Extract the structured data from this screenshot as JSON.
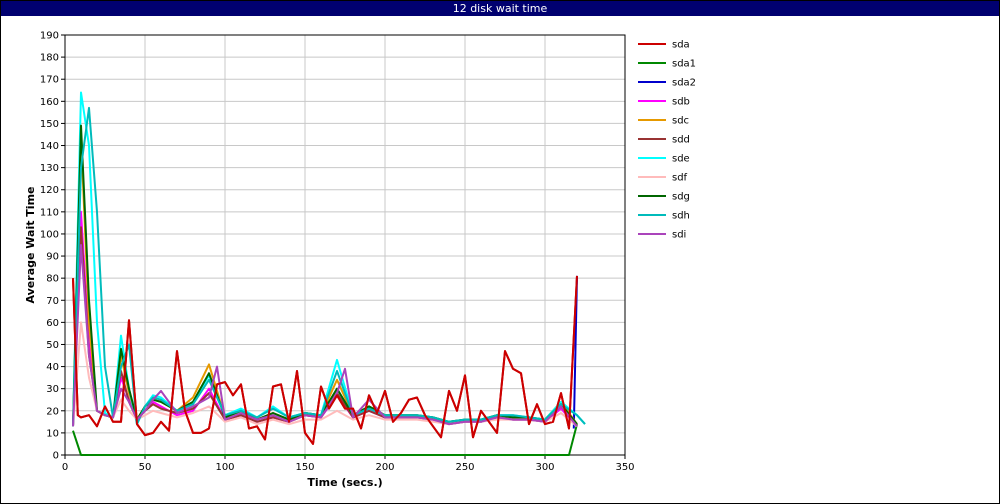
{
  "chart_data": {
    "type": "line",
    "title": "12 disk wait time",
    "xlabel": "Time (secs.)",
    "ylabel": "Average Wait Time",
    "xlim": [
      0,
      350
    ],
    "ylim": [
      0,
      190
    ],
    "xticks": [
      0,
      50,
      100,
      150,
      200,
      250,
      300,
      350
    ],
    "yticks": [
      0,
      10,
      20,
      30,
      40,
      50,
      60,
      70,
      80,
      90,
      100,
      110,
      120,
      130,
      140,
      150,
      160,
      170,
      180,
      190
    ],
    "grid": true,
    "legend_position": "right",
    "series": [
      {
        "name": "sda",
        "color": "#cc0000",
        "x": [
          5,
          8,
          10,
          15,
          20,
          25,
          30,
          35,
          40,
          45,
          50,
          55,
          60,
          65,
          70,
          75,
          80,
          85,
          90,
          95,
          100,
          105,
          110,
          115,
          120,
          125,
          130,
          135,
          140,
          145,
          150,
          155,
          160,
          165,
          170,
          175,
          180,
          185,
          190,
          195,
          200,
          205,
          210,
          215,
          220,
          225,
          230,
          235,
          240,
          245,
          250,
          255,
          260,
          265,
          270,
          275,
          280,
          285,
          290,
          295,
          300,
          305,
          310,
          315,
          320
        ],
        "y": [
          80,
          18,
          17,
          18,
          13,
          22,
          15,
          15,
          61,
          14,
          9,
          10,
          15,
          11,
          47,
          20,
          10,
          10,
          12,
          32,
          33,
          27,
          32,
          12,
          13,
          7,
          31,
          32,
          15,
          38,
          10,
          5,
          31,
          21,
          27,
          21,
          21,
          12,
          27,
          19,
          29,
          15,
          19,
          25,
          26,
          18,
          13,
          8,
          29,
          20,
          36,
          8,
          20,
          15,
          10,
          47,
          39,
          37,
          14,
          23,
          14,
          15,
          28,
          12,
          81
        ]
      },
      {
        "name": "sda1",
        "color": "#008800",
        "x": [
          5,
          10,
          20,
          50,
          100,
          150,
          200,
          250,
          300,
          310,
          315,
          320
        ],
        "y": [
          11,
          0,
          0,
          0,
          0,
          0,
          0,
          0,
          0,
          0,
          0,
          14
        ]
      },
      {
        "name": "sda2",
        "color": "#0000cc",
        "x": [
          318,
          320
        ],
        "y": [
          12,
          81
        ]
      },
      {
        "name": "sdb",
        "color": "#ff00ff",
        "x": [
          5,
          10,
          15,
          20,
          25,
          30,
          35,
          40,
          45,
          50,
          55,
          60,
          70,
          80,
          90,
          100,
          110,
          120,
          130,
          140,
          150,
          160,
          170,
          180,
          190,
          200,
          210,
          220,
          230,
          240,
          250,
          260,
          270,
          280,
          290,
          300,
          310,
          320
        ],
        "y": [
          13,
          110,
          50,
          20,
          18,
          17,
          35,
          25,
          16,
          20,
          24,
          22,
          18,
          20,
          30,
          16,
          18,
          15,
          17,
          15,
          18,
          17,
          27,
          17,
          20,
          17,
          17,
          17,
          16,
          14,
          15,
          15,
          17,
          16,
          16,
          15,
          21,
          13
        ]
      },
      {
        "name": "sdc",
        "color": "#e69900",
        "x": [
          5,
          10,
          15,
          20,
          25,
          30,
          35,
          40,
          45,
          50,
          55,
          60,
          70,
          80,
          90,
          100,
          110,
          120,
          130,
          140,
          150,
          160,
          170,
          180,
          190,
          200,
          210,
          220,
          230,
          240,
          250,
          260,
          270,
          280,
          290,
          300,
          310,
          320
        ],
        "y": [
          13,
          144,
          60,
          20,
          18,
          17,
          45,
          28,
          16,
          22,
          25,
          24,
          20,
          26,
          41,
          17,
          20,
          16,
          19,
          16,
          19,
          18,
          34,
          18,
          22,
          18,
          18,
          18,
          17,
          15,
          16,
          16,
          18,
          17,
          17,
          16,
          24,
          14
        ]
      },
      {
        "name": "sdd",
        "color": "#993333",
        "x": [
          5,
          10,
          15,
          20,
          25,
          30,
          35,
          40,
          45,
          50,
          55,
          60,
          70,
          80,
          90,
          100,
          110,
          120,
          130,
          140,
          150,
          160,
          170,
          180,
          190,
          200,
          210,
          220,
          230,
          240,
          250,
          260,
          270,
          280,
          290,
          300,
          310,
          320
        ],
        "y": [
          13,
          103,
          45,
          20,
          18,
          17,
          38,
          24,
          16,
          20,
          23,
          21,
          19,
          21,
          28,
          16,
          18,
          15,
          17,
          15,
          18,
          17,
          28,
          17,
          20,
          17,
          17,
          17,
          16,
          14,
          15,
          15,
          17,
          16,
          16,
          15,
          22,
          13
        ]
      },
      {
        "name": "sde",
        "color": "#00ffff",
        "x": [
          5,
          10,
          15,
          20,
          25,
          30,
          35,
          40,
          45,
          50,
          55,
          60,
          70,
          80,
          90,
          100,
          110,
          120,
          130,
          140,
          150,
          160,
          170,
          180,
          190,
          200,
          210,
          220,
          230,
          240,
          250,
          260,
          270,
          280,
          290,
          300,
          310,
          320,
          325
        ],
        "y": [
          13,
          164,
          140,
          60,
          19,
          17,
          54,
          30,
          14,
          22,
          27,
          26,
          20,
          24,
          36,
          18,
          21,
          17,
          22,
          17,
          19,
          18,
          43,
          18,
          21,
          18,
          18,
          18,
          17,
          15,
          16,
          16,
          18,
          18,
          17,
          16,
          24,
          18,
          14
        ]
      },
      {
        "name": "sdf",
        "color": "#ffbbbb",
        "x": [
          5,
          10,
          15,
          20,
          25,
          30,
          35,
          40,
          45,
          50,
          55,
          60,
          70,
          80,
          90,
          100,
          110,
          120,
          130,
          140,
          150,
          160,
          170,
          180,
          190,
          200,
          210,
          220,
          230,
          240,
          250,
          260,
          270,
          280,
          290,
          300,
          310,
          320
        ],
        "y": [
          13,
          60,
          35,
          20,
          18,
          17,
          25,
          20,
          16,
          18,
          20,
          19,
          17,
          19,
          22,
          15,
          17,
          14,
          16,
          14,
          16,
          16,
          20,
          16,
          18,
          16,
          16,
          16,
          15,
          14,
          15,
          15,
          16,
          16,
          16,
          15,
          19,
          13
        ]
      },
      {
        "name": "sdg",
        "color": "#006600",
        "x": [
          5,
          10,
          15,
          20,
          25,
          30,
          35,
          40,
          45,
          50,
          55,
          60,
          70,
          80,
          90,
          100,
          110,
          120,
          130,
          140,
          150,
          160,
          170,
          180,
          190,
          200,
          210,
          220,
          230,
          240,
          250,
          260,
          270,
          280,
          290,
          300,
          310,
          320
        ],
        "y": [
          13,
          149,
          70,
          20,
          18,
          17,
          48,
          30,
          16,
          22,
          25,
          24,
          20,
          24,
          37,
          17,
          20,
          16,
          19,
          16,
          19,
          18,
          30,
          18,
          22,
          18,
          18,
          18,
          17,
          15,
          16,
          16,
          18,
          17,
          17,
          16,
          23,
          14
        ]
      },
      {
        "name": "sdh",
        "color": "#00bbbb",
        "x": [
          5,
          10,
          15,
          20,
          25,
          30,
          35,
          40,
          45,
          50,
          55,
          60,
          70,
          80,
          90,
          100,
          110,
          120,
          130,
          140,
          150,
          160,
          170,
          180,
          190,
          200,
          210,
          220,
          230,
          240,
          250,
          260,
          270,
          280,
          290,
          300,
          310,
          320,
          325
        ],
        "y": [
          13,
          130,
          157,
          110,
          40,
          17,
          40,
          50,
          14,
          22,
          26,
          25,
          20,
          23,
          34,
          18,
          20,
          17,
          21,
          17,
          19,
          18,
          38,
          18,
          21,
          18,
          18,
          18,
          17,
          15,
          16,
          16,
          18,
          18,
          17,
          16,
          23,
          18,
          14
        ]
      },
      {
        "name": "sdi",
        "color": "#aa44bb",
        "x": [
          5,
          10,
          15,
          20,
          25,
          30,
          35,
          40,
          45,
          50,
          55,
          60,
          70,
          80,
          90,
          95,
          100,
          110,
          120,
          130,
          140,
          150,
          160,
          170,
          175,
          180,
          190,
          200,
          210,
          220,
          230,
          240,
          250,
          260,
          270,
          280,
          290,
          300,
          310,
          320
        ],
        "y": [
          13,
          95,
          45,
          20,
          18,
          17,
          30,
          24,
          16,
          20,
          25,
          29,
          19,
          22,
          26,
          40,
          16,
          19,
          16,
          18,
          15,
          18,
          17,
          28,
          39,
          17,
          25,
          17,
          17,
          17,
          16,
          14,
          15,
          15,
          17,
          16,
          16,
          15,
          22,
          13
        ]
      }
    ]
  }
}
